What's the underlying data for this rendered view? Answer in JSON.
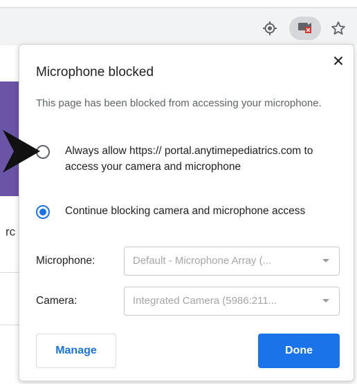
{
  "toolbar": {
    "icons": [
      "location-target-icon",
      "camera-blocked-icon",
      "bookmark-star-icon"
    ]
  },
  "background": {
    "fragment_text": "rc"
  },
  "popup": {
    "title": "Microphone blocked",
    "description": "This page has been blocked from accessing your microphone.",
    "options": [
      {
        "label": "Always allow https:// portal.anytimepediatrics.com to access your camera and microphone",
        "checked": false
      },
      {
        "label": "Continue blocking camera and microphone access",
        "checked": true
      }
    ],
    "microphone": {
      "label": "Microphone:",
      "value": "Default - Microphone Array (..."
    },
    "camera": {
      "label": "Camera:",
      "value": "Integrated Camera (5986:211..."
    },
    "manage_label": "Manage",
    "done_label": "Done"
  },
  "colors": {
    "accent": "#1a73e8",
    "page_purple": "#6a54a6"
  }
}
